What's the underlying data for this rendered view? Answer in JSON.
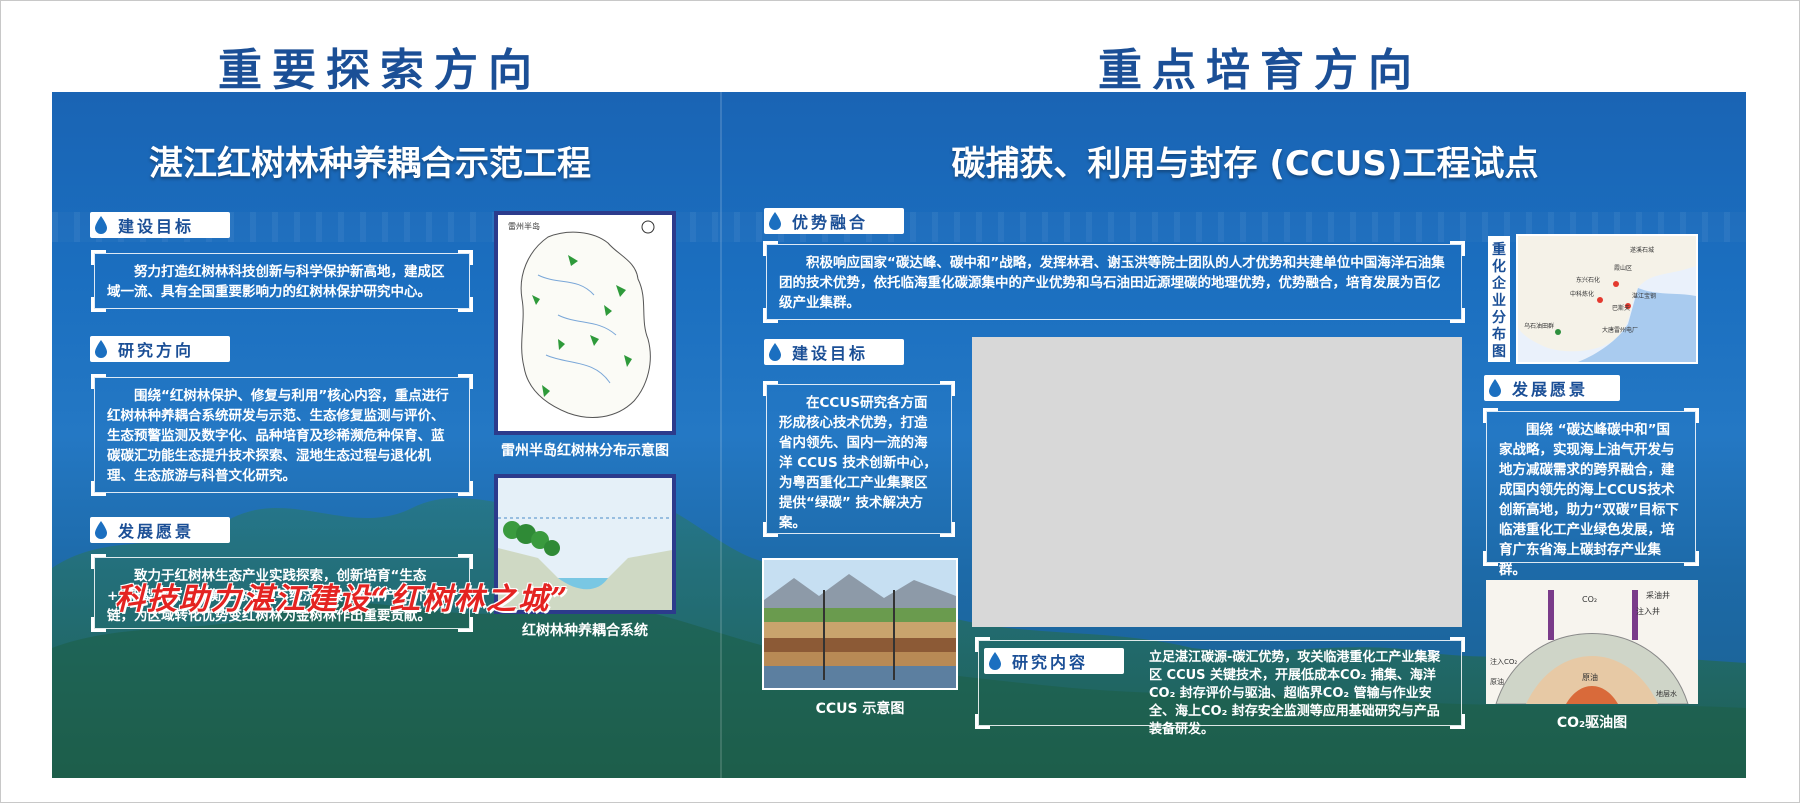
{
  "headers": {
    "left": "重要探索方向",
    "right": "重点培育方向"
  },
  "left": {
    "subtitle": "湛江红树林种养耦合示范工程",
    "goal": {
      "label": "建设目标",
      "text": "努力打造红树林科技创新与科学保护新高地，建成区域一流、具有全国重要影响力的红树林保护研究中心。"
    },
    "research": {
      "label": "研究方向",
      "text": "围绕“红树林保护、修复与利用”核心内容，重点进行红树林种养耦合系统研发与示范、生态修复监测与评价、生态预警监测及数字化、品种培育及珍稀濒危种保育、蓝碳碳汇功能生态提升技术探索、湿地生态过程与退化机理、生态旅游与科普文化研究。"
    },
    "vision": {
      "label": "发展愿景",
      "text": "致力于红树林生态产业实践探索，创新培育“生态+”新型业态，平衡生态保护与经济发展，延伸产业价值链，为区域转化优势变红树林为金树林作出重要贡献。"
    },
    "map_caption": "雷州半岛红树林分布示意图",
    "map_label": "雷州半岛",
    "system_caption": "红树林种养耦合系统",
    "slogan": "科技助力湛江建设“红树林之城”"
  },
  "right": {
    "subtitle": "碳捕获、利用与封存 (CCUS)工程试点",
    "advantage": {
      "label": "优势融合",
      "text": "积极响应国家“碳达峰、碳中和”战略，发挥林君、谢玉洪等院士团队的人才优势和共建单位中国海洋石油集团的技术优势，依托临海重化碳源集中的产业优势和乌石油田近源埋碳的地理优势，优势融合，培育发展为百亿级产业集群。"
    },
    "goal": {
      "label": "建设目标",
      "text": "在CCUS研究各方面形成核心技术优势，打造省内领先、国内一流的海洋 CCUS 技术创新中心，为粤西重化工产业集聚区提供“绿碳” 技术解决方案。"
    },
    "ccus_caption": "CCUS 示意图",
    "research": {
      "label": "研究内容",
      "text": "立足湛江碳源-碳汇优势，攻关临港重化工产业集聚区 CCUS 关键技术，开展低成本CO₂ 捕集、海洋CO₂ 封存评价与驱油、超临界CO₂ 管输与作业安全、海上CO₂ 封存安全监测等应用基础研究与产品装备研发。"
    },
    "map_vlabel": "重化企业分布图",
    "vision": {
      "label": "发展愿景",
      "text": "围绕 “碳达峰碳中和”国家战略，实现海上油气开发与地方减碳需求的跨界融合，建成国内领先的海上CCUS技术创新高地，助力“双碳”目标下临港重化工产业绿色发展，培育广东省海上碳封存产业集群。"
    },
    "oil_caption": "CO₂驱油图",
    "oil_labels": {
      "co2": "CO₂",
      "well": "采油井",
      "inject": "注入井",
      "inject_co2": "注入CO₂",
      "crude": "原油",
      "crude2": "原油",
      "formation": "地层水"
    },
    "map_places": [
      "遂溪石城",
      "霞山区",
      "东兴石化",
      "中科炼化",
      "湛江宝钢",
      "巴斯夫",
      "乌石油田群",
      "大唐雷州电厂"
    ]
  },
  "colors": {
    "header": "#1b4f96",
    "panel": "#1b6fc0",
    "slogan": "#e42321"
  }
}
